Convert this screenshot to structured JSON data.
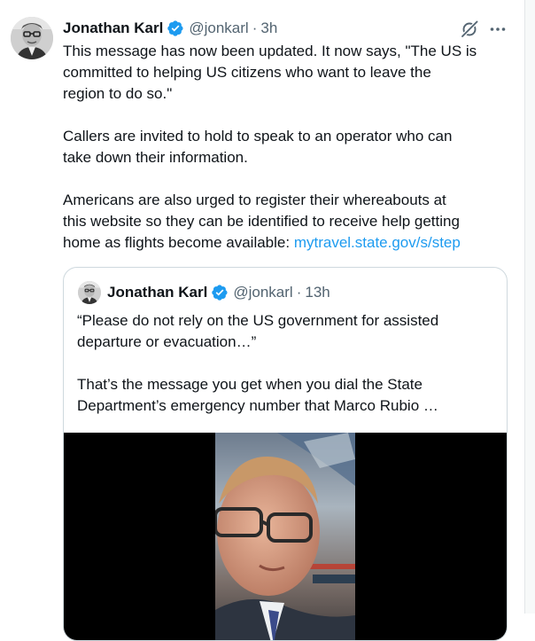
{
  "tweet": {
    "author_name": "Jonathan Karl",
    "handle": "@jonkarl",
    "separator": "·",
    "time": "3h",
    "paragraphs": [
      [
        "This message has now been updated. It now says, \"The US is",
        "committed to helping US citizens who want to leave the",
        "region to do so.\""
      ],
      [
        "Callers are invited to hold to speak to an operator who can",
        "take down their information."
      ],
      [
        "Americans are also urged to register their whereabouts at",
        "this website so they can be identified to receive help getting"
      ]
    ],
    "last_line_text": "home as flights become available: ",
    "link_text": "mytravel.state.gov/s/step"
  },
  "quote": {
    "author_name": "Jonathan Karl",
    "handle": "@jonkarl",
    "separator": "·",
    "time": "13h",
    "paragraphs": [
      [
        "“Please do not rely on the US government for assisted",
        "departure or evacuation…”"
      ],
      [
        "That’s the message you get when you dial the State",
        "Department’s emergency number that Marco Rubio …"
      ]
    ]
  },
  "icons": {
    "verified": "verified-badge-icon",
    "grok": "grok-icon",
    "more": "more-options-icon"
  },
  "colors": {
    "text": "#0f1419",
    "secondary": "#536471",
    "link": "#1d9bf0",
    "verified": "#1d9bf0",
    "border": "#cfd9de"
  }
}
